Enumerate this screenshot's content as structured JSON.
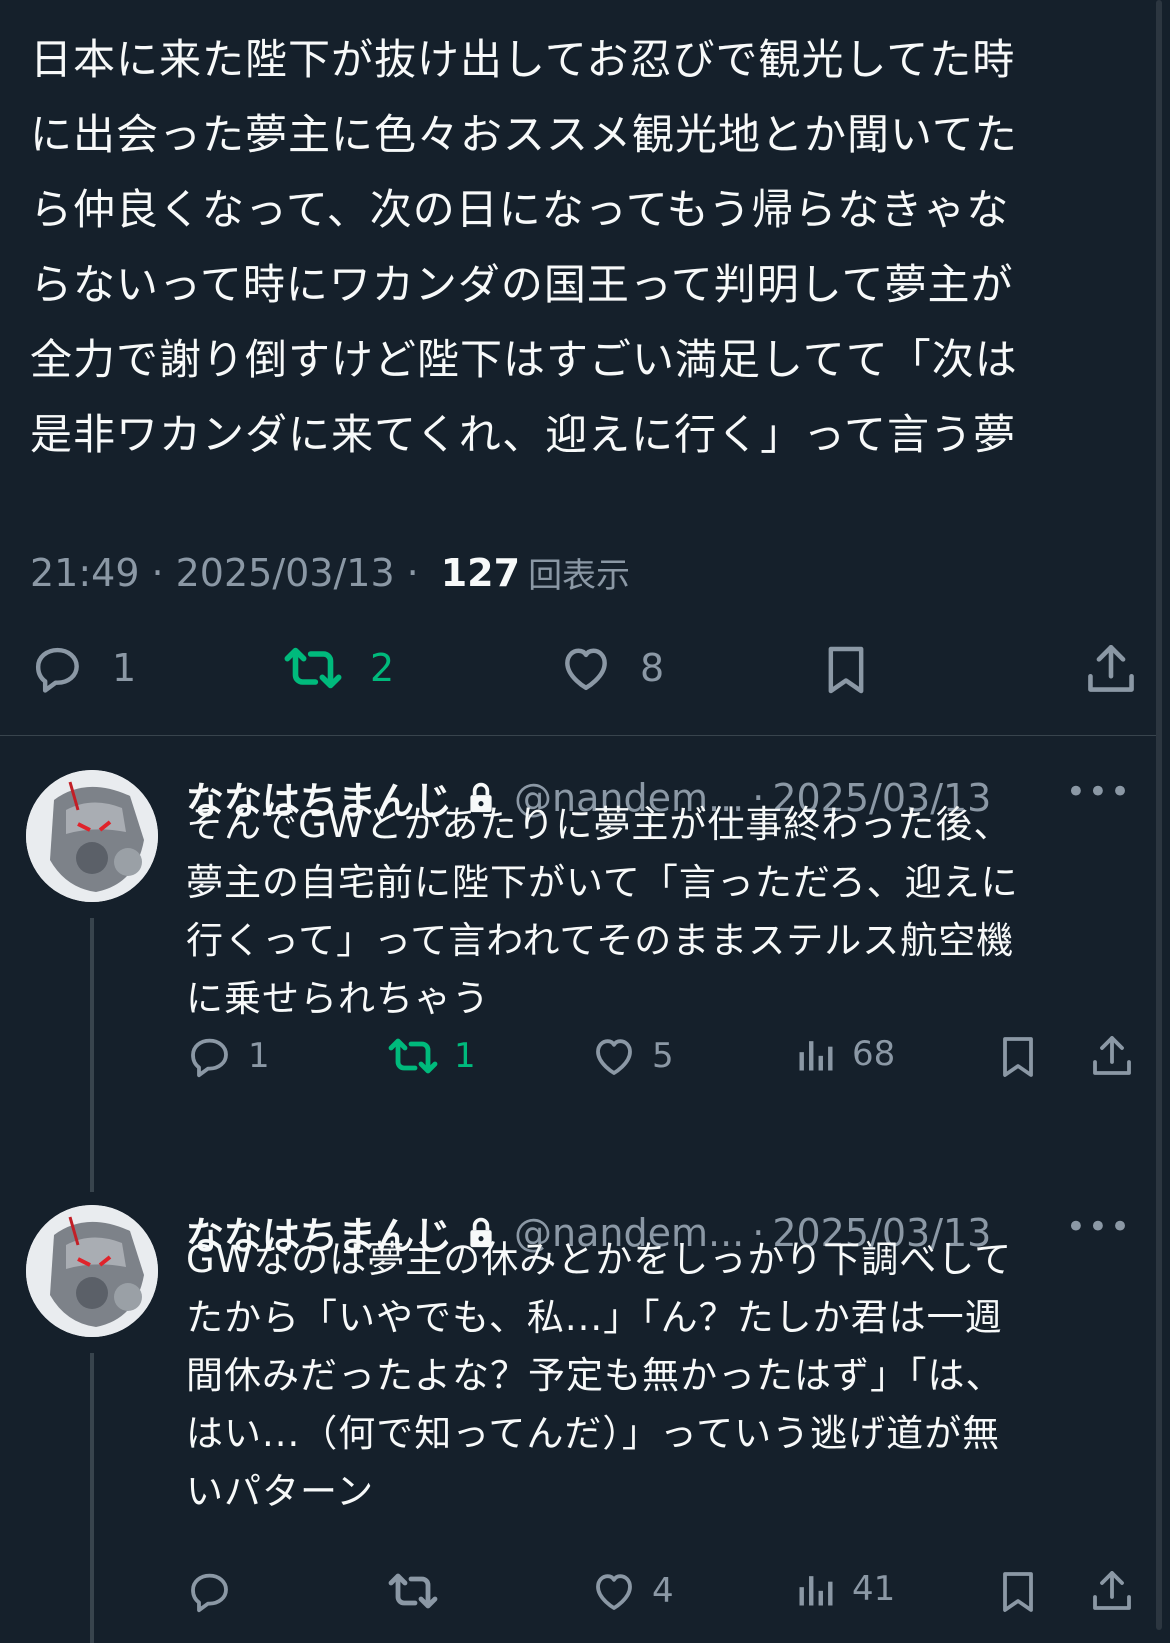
{
  "main_tweet": {
    "text": "日本に来た陛下が抜け出してお忍びで観光してた時\nに出会った夢主に色々おススメ観光地とか聞いてた\nら仲良くなって、次の日になってもう帰らなきゃな\nらないって時にワカンダの国王って判明して夢主が\n全力で謝り倒すけど陛下はすごい満足してて「次は\n是非ワカンダに来てくれ、迎えに行く」って言う夢",
    "time": "21:49",
    "separator": "·",
    "date": "2025/03/13",
    "views_count": "127",
    "views_label": "回表示",
    "actions": {
      "replies": "1",
      "reposts": "2",
      "likes": "8"
    }
  },
  "replies": [
    {
      "name": "ななはちまんじ",
      "handle": "@nandem...",
      "separator": "·",
      "date": "2025/03/13",
      "more": "•••",
      "text": "そんでGWとかあたりに夢主が仕事終わった後、\n夢主の自宅前に陛下がいて「言っただろ、迎えに\n行くって」って言われてそのままステルス航空機\nに乗せられちゃう",
      "actions": {
        "replies": "1",
        "reposts": "1",
        "likes": "5",
        "views": "68"
      }
    },
    {
      "name": "ななはちまんじ",
      "handle": "@nandem...",
      "separator": "·",
      "date": "2025/03/13",
      "more": "•••",
      "text": "GWなのは夢主の休みとかをしっかり下調べして\nたから「いやでも、私...」「ん？たしか君は一週\n間休みだったよな？予定も無かったはず」「は、\nはい...（何で知ってんだ）」っていう逃げ道が無\nいパターン",
      "actions": {
        "likes": "4",
        "views": "41"
      }
    }
  ],
  "colors": {
    "background": "#15202b",
    "text": "#f7f9f9",
    "muted": "#8b98a5",
    "repost_active": "#00ba7c",
    "divider": "#38444d"
  }
}
